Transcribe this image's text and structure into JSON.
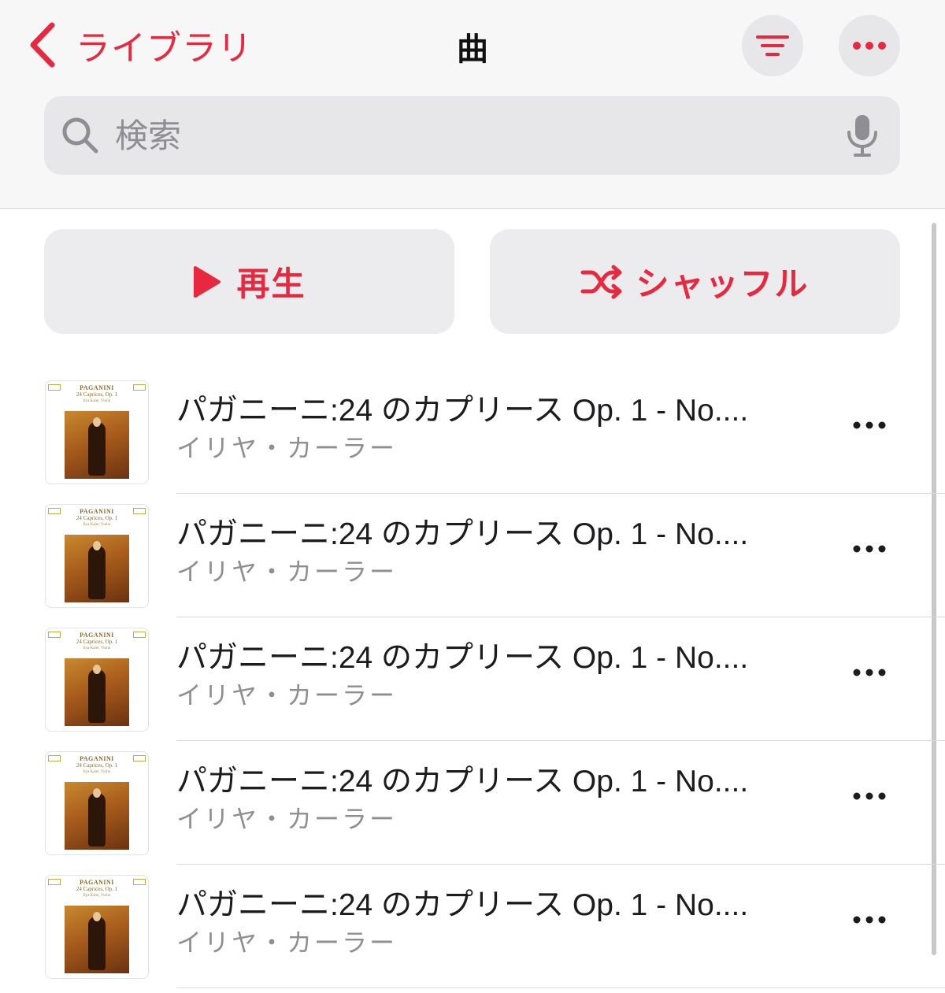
{
  "header": {
    "back_label": "ライブラリ",
    "title": "曲"
  },
  "search": {
    "placeholder": "検索"
  },
  "actions": {
    "play_label": "再生",
    "shuffle_label": "シャッフル"
  },
  "songs": [
    {
      "title": "パガニーニ:24 のカプリース Op. 1 - No....",
      "artist": "イリヤ・カーラー",
      "art_title": "PAGANINI",
      "art_subtitle": "24 Caprices, Op. 1",
      "art_performer": "Ilya Kaler, Violin"
    },
    {
      "title": "パガニーニ:24 のカプリース Op. 1 - No....",
      "artist": "イリヤ・カーラー",
      "art_title": "PAGANINI",
      "art_subtitle": "24 Caprices, Op. 1",
      "art_performer": "Ilya Kaler, Violin"
    },
    {
      "title": "パガニーニ:24 のカプリース Op. 1 - No....",
      "artist": "イリヤ・カーラー",
      "art_title": "PAGANINI",
      "art_subtitle": "24 Caprices, Op. 1",
      "art_performer": "Ilya Kaler, Violin"
    },
    {
      "title": "パガニーニ:24 のカプリース Op. 1 - No....",
      "artist": "イリヤ・カーラー",
      "art_title": "PAGANINI",
      "art_subtitle": "24 Caprices, Op. 1",
      "art_performer": "Ilya Kaler, Violin"
    },
    {
      "title": "パガニーニ:24 のカプリース Op. 1 - No....",
      "artist": "イリヤ・カーラー",
      "art_title": "PAGANINI",
      "art_subtitle": "24 Caprices, Op. 1",
      "art_performer": "Ilya Kaler, Violin"
    }
  ],
  "colors": {
    "accent": "#e8283f",
    "secondary_text": "#8e8e93",
    "button_background": "#ececee"
  },
  "icons": [
    "chevron-left-icon",
    "filter-icon",
    "ellipsis-icon",
    "search-icon",
    "microphone-icon",
    "play-icon",
    "shuffle-icon"
  ]
}
